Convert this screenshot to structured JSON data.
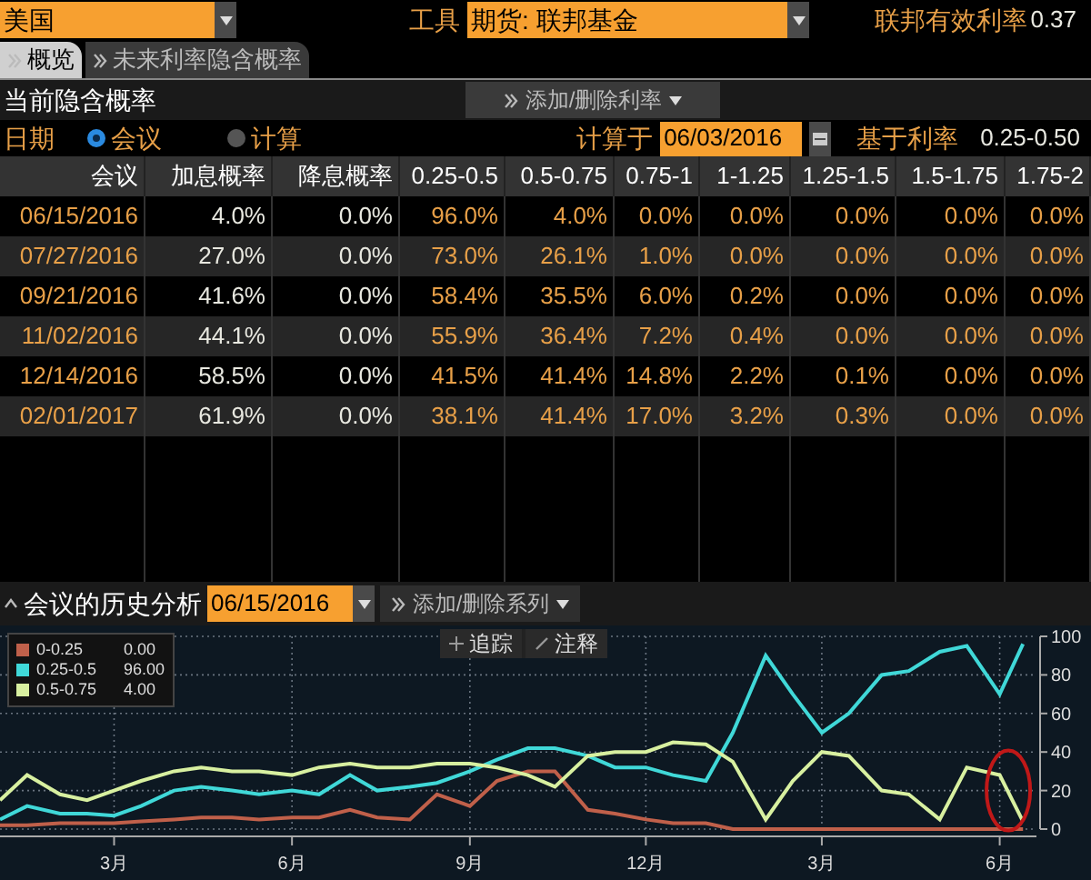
{
  "top_bar": {
    "country": {
      "value": "美国"
    },
    "instrument_label": "工具",
    "instrument": {
      "value": "期货: 联邦基金"
    },
    "effective_rate_label": "联邦有效利率",
    "effective_rate": "0.37"
  },
  "tabs": [
    {
      "label": "概览",
      "selected": true
    },
    {
      "label": "未来利率隐含概率",
      "selected": false
    }
  ],
  "section": {
    "title": "当前隐含概率",
    "action_button": "添加/删除利率"
  },
  "options": {
    "date_label": "日期",
    "radios": [
      {
        "label": "会议",
        "selected": true
      },
      {
        "label": "计算",
        "selected": false
      }
    ],
    "calc_label": "计算于",
    "calc_date": "06/03/2016",
    "base_rate_label": "基于利率",
    "base_rate": "0.25-0.50"
  },
  "table": {
    "columns": [
      {
        "label": "会议",
        "kind": "date"
      },
      {
        "label": "加息概率",
        "kind": "move"
      },
      {
        "label": "降息概率",
        "kind": "move"
      },
      {
        "label": "0.25-0.5",
        "kind": "range"
      },
      {
        "label": "0.5-0.75",
        "kind": "range"
      },
      {
        "label": "0.75-1",
        "kind": "range"
      },
      {
        "label": "1-1.25",
        "kind": "range"
      },
      {
        "label": "1.25-1.5",
        "kind": "range"
      },
      {
        "label": "1.5-1.75",
        "kind": "range"
      },
      {
        "label": "1.75-2",
        "kind": "range"
      }
    ],
    "rows": [
      [
        "06/15/2016",
        "4.0%",
        "0.0%",
        "96.0%",
        "4.0%",
        "0.0%",
        "0.0%",
        "0.0%",
        "0.0%",
        "0.0%"
      ],
      [
        "07/27/2016",
        "27.0%",
        "0.0%",
        "73.0%",
        "26.1%",
        "1.0%",
        "0.0%",
        "0.0%",
        "0.0%",
        "0.0%"
      ],
      [
        "09/21/2016",
        "41.6%",
        "0.0%",
        "58.4%",
        "35.5%",
        "6.0%",
        "0.2%",
        "0.0%",
        "0.0%",
        "0.0%"
      ],
      [
        "11/02/2016",
        "44.1%",
        "0.0%",
        "55.9%",
        "36.4%",
        "7.2%",
        "0.4%",
        "0.0%",
        "0.0%",
        "0.0%"
      ],
      [
        "12/14/2016",
        "58.5%",
        "0.0%",
        "41.5%",
        "41.4%",
        "14.8%",
        "2.2%",
        "0.1%",
        "0.0%",
        "0.0%"
      ],
      [
        "02/01/2017",
        "61.9%",
        "0.0%",
        "38.1%",
        "41.4%",
        "17.0%",
        "3.2%",
        "0.3%",
        "0.0%",
        "0.0%"
      ]
    ]
  },
  "history": {
    "title": "会议的历史分析",
    "meeting_date": "06/15/2016",
    "action_button": "添加/删除系列",
    "chart_buttons": [
      "追踪",
      "注释"
    ],
    "legend": [
      {
        "value": "0.00"
      },
      {
        "value": "96.00"
      },
      {
        "value": "4.00"
      }
    ],
    "highlight": {
      "color": "#c01818"
    },
    "chart_data": {
      "type": "line",
      "grid": true,
      "legend": "upper left",
      "x": [
        "2015-01-01",
        "2015-01-15",
        "2015-02-01",
        "2015-02-15",
        "2015-03-01",
        "2015-03-15",
        "2015-04-01",
        "2015-04-15",
        "2015-05-01",
        "2015-05-15",
        "2015-06-01",
        "2015-06-15",
        "2015-07-01",
        "2015-07-15",
        "2015-08-01",
        "2015-08-15",
        "2015-09-01",
        "2015-09-15",
        "2015-10-01",
        "2015-10-15",
        "2015-11-01",
        "2015-11-15",
        "2015-12-01",
        "2015-12-15",
        "2016-01-01",
        "2016-01-15",
        "2016-02-01",
        "2016-02-15",
        "2016-03-01",
        "2016-03-15",
        "2016-04-01",
        "2016-04-15",
        "2016-05-01",
        "2016-05-15",
        "2016-06-01",
        "2016-06-13"
      ],
      "xlim": [
        "2015-01-01",
        "2016-06-20"
      ],
      "ylim": [
        0,
        100
      ],
      "xticks": [
        {
          "value": "2015-03-01",
          "label": "3月"
        },
        {
          "value": "2015-06-01",
          "label": "6月"
        },
        {
          "value": "2015-09-01",
          "label": "9月"
        },
        {
          "value": "2015-12-01",
          "label": "12月"
        },
        {
          "value": "2016-03-01",
          "label": "3月"
        },
        {
          "value": "2016-06-01",
          "label": "6月"
        }
      ],
      "yticks": [
        0,
        20,
        40,
        60,
        80,
        100
      ],
      "series": [
        {
          "name": "0-0.25",
          "color": "#c0604a",
          "values": [
            2,
            2,
            3,
            3,
            3,
            4,
            5,
            6,
            6,
            5,
            6,
            6,
            10,
            6,
            5,
            18,
            12,
            25,
            30,
            30,
            10,
            8,
            5,
            3,
            3,
            0,
            0,
            0,
            0,
            0,
            0,
            0,
            0,
            0,
            0,
            0
          ]
        },
        {
          "name": "0.25-0.5",
          "color": "#40d8d8",
          "values": [
            5,
            12,
            8,
            8,
            7,
            12,
            20,
            22,
            20,
            18,
            20,
            18,
            28,
            20,
            22,
            24,
            30,
            36,
            42,
            42,
            38,
            32,
            32,
            28,
            25,
            50,
            90,
            70,
            50,
            60,
            80,
            82,
            92,
            95,
            70,
            96
          ]
        },
        {
          "name": "0.5-0.75",
          "color": "#d8f0a0",
          "values": [
            15,
            28,
            18,
            15,
            20,
            25,
            30,
            32,
            30,
            30,
            28,
            32,
            34,
            32,
            32,
            34,
            34,
            32,
            28,
            22,
            38,
            40,
            40,
            45,
            44,
            35,
            5,
            25,
            40,
            38,
            20,
            18,
            5,
            32,
            28,
            4
          ]
        }
      ]
    }
  }
}
